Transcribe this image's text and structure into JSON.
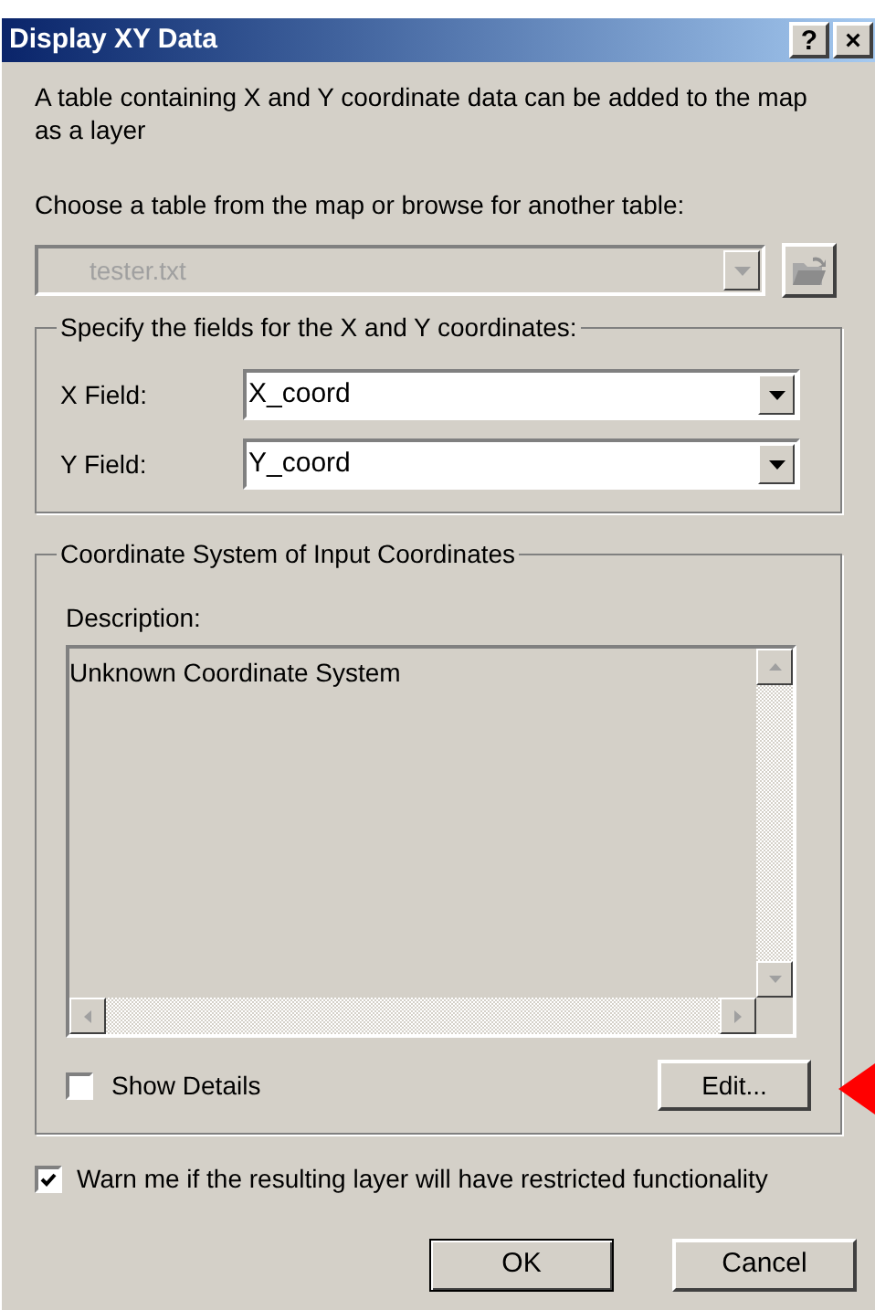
{
  "window": {
    "title": "Display XY Data",
    "title_buttons": [
      "?",
      "×"
    ]
  },
  "intro": "A table containing X and Y coordinate data can be added to the map as a layer",
  "table_prompt": "Choose a table from the map or browse for another table:",
  "table_combo": {
    "value": "tester.txt",
    "disabled": true
  },
  "fields_group": {
    "legend": "Specify the fields for the X and Y coordinates:",
    "fields": [
      {
        "label": "X Field:",
        "value": "X_coord"
      },
      {
        "label": "Y Field:",
        "value": "Y_coord"
      }
    ]
  },
  "coord_group": {
    "legend": "Coordinate System of Input Coordinates",
    "description_label": "Description:",
    "description": "Unknown Coordinate System",
    "show_details": {
      "label": "Show Details",
      "checked": false
    },
    "edit_button": "Edit..."
  },
  "warn": {
    "label": "Warn me if the resulting layer will have restricted functionality",
    "checked": true
  },
  "buttons": [
    {
      "label": "OK",
      "default": true
    },
    {
      "label": "Cancel",
      "default": false
    }
  ]
}
